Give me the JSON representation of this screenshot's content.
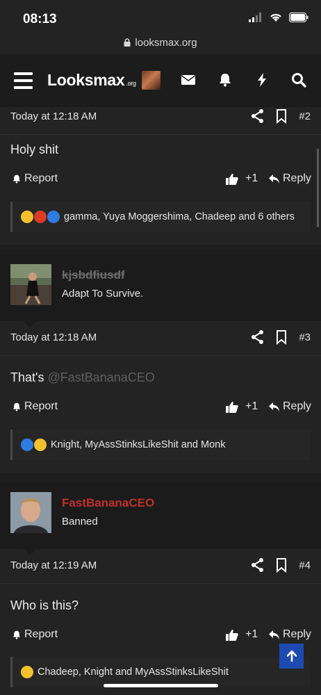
{
  "status": {
    "time": "08:13"
  },
  "browser": {
    "url": "looksmax.org"
  },
  "nav": {
    "logo_main": "Looksmax",
    "logo_suffix": ".org"
  },
  "colors": {
    "background": "#232323",
    "nav": "#1c1c1c",
    "banned_name": "#c0312a",
    "accent": "#1d4ab0",
    "mention": "#5f5f5f"
  },
  "posts": [
    {
      "date": "Today at 12:18 AM",
      "number": "#2",
      "body": "Holy shit",
      "report_label": "Report",
      "like_label": "+1",
      "reply_label": "Reply",
      "reactions_text": "gamma, Yuya Moggershima, Chadeep and 6 others"
    },
    {
      "user": {
        "name": "kjsbdfiusdf",
        "title": "Adapt To Survive."
      },
      "date": "Today at 12:18 AM",
      "number": "#3",
      "body": "That's ",
      "mention": "@FastBananaCEO",
      "report_label": "Report",
      "like_label": "+1",
      "reply_label": "Reply",
      "reactions_text": "Knight, MyAssStinksLikeShit and Monk"
    },
    {
      "user": {
        "name": "FastBananaCEO",
        "title": "Banned"
      },
      "date": "Today at 12:19 AM",
      "number": "#4",
      "body": "Who is this?",
      "report_label": "Report",
      "like_label": "+1",
      "reply_label": "Reply",
      "reactions_text": "Chadeep, Knight and MyAssStinksLikeShit"
    }
  ]
}
